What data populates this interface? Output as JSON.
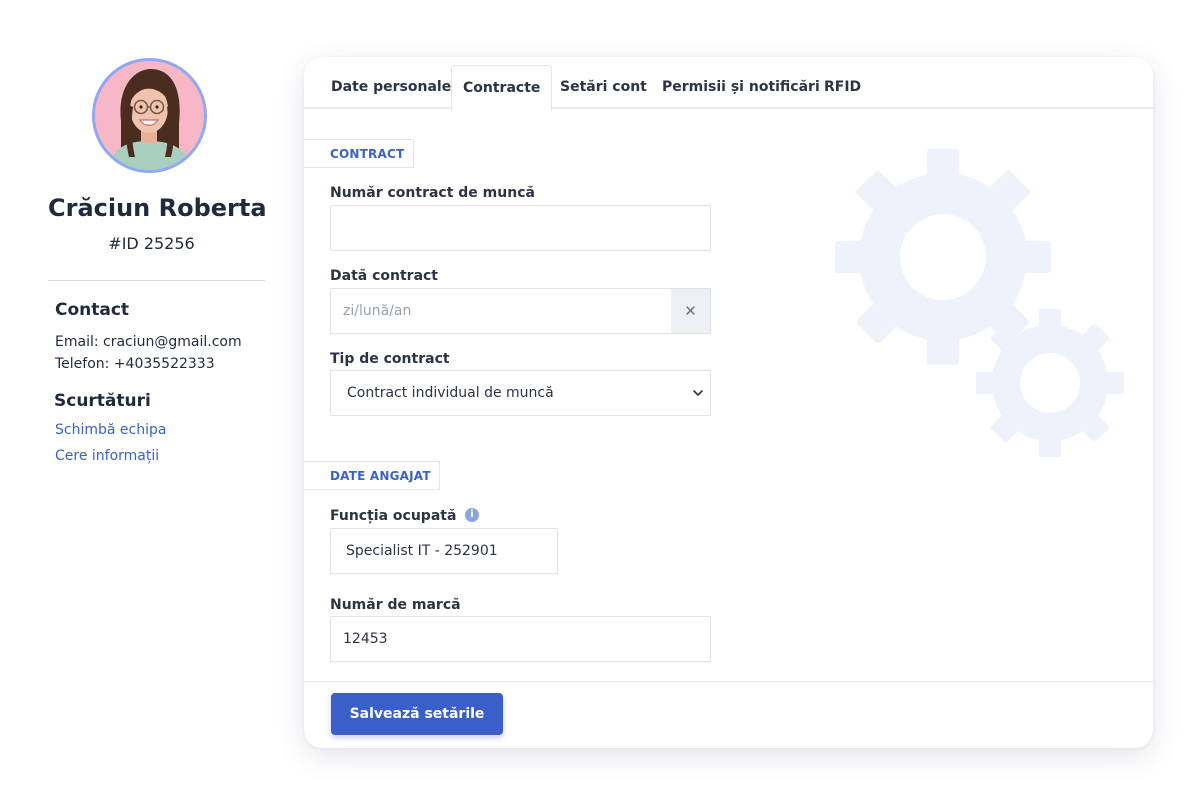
{
  "profile": {
    "name": "Crăciun Roberta",
    "id": "#ID 25256",
    "contact_title": "Contact",
    "email": "Email: craciun@gmail.com",
    "phone": "Telefon: +4035522333",
    "shortcuts_title": "Scurtături",
    "shortcuts": [
      "Schimbă echipa",
      "Cere informații"
    ]
  },
  "tabs": [
    "Date personale",
    "Contracte",
    "Setări cont",
    "Permisii și notificări",
    "RFID"
  ],
  "active_tab": "Contracte",
  "sections": {
    "contract": {
      "label": "CONTRACT",
      "contract_number_label": "Număr contract de muncă",
      "contract_number_value": "",
      "contract_date_label": "Dată contract",
      "contract_date_placeholder": "zi/lună/an",
      "contract_type_label": "Tip de contract",
      "contract_type_value": "Contract individual de muncă"
    },
    "employee": {
      "label": "DATE ANGAJAT",
      "function_label": "Funcția ocupată",
      "function_value": "Specialist IT - 252901",
      "badge_number_label": "Număr de marcă",
      "badge_number_value": "12453"
    }
  },
  "buttons": {
    "save": "Salvează setările",
    "clear": "✕"
  },
  "icons": {
    "info": "info-icon",
    "clear": "close-icon",
    "dropdown": "chevron-down-icon",
    "decoration": "gears-illustration"
  },
  "colors": {
    "accent": "#3a5fc8",
    "link": "#3a62c8",
    "avatar_ring": "#8ea8f4",
    "gears": "#eef3fb"
  }
}
